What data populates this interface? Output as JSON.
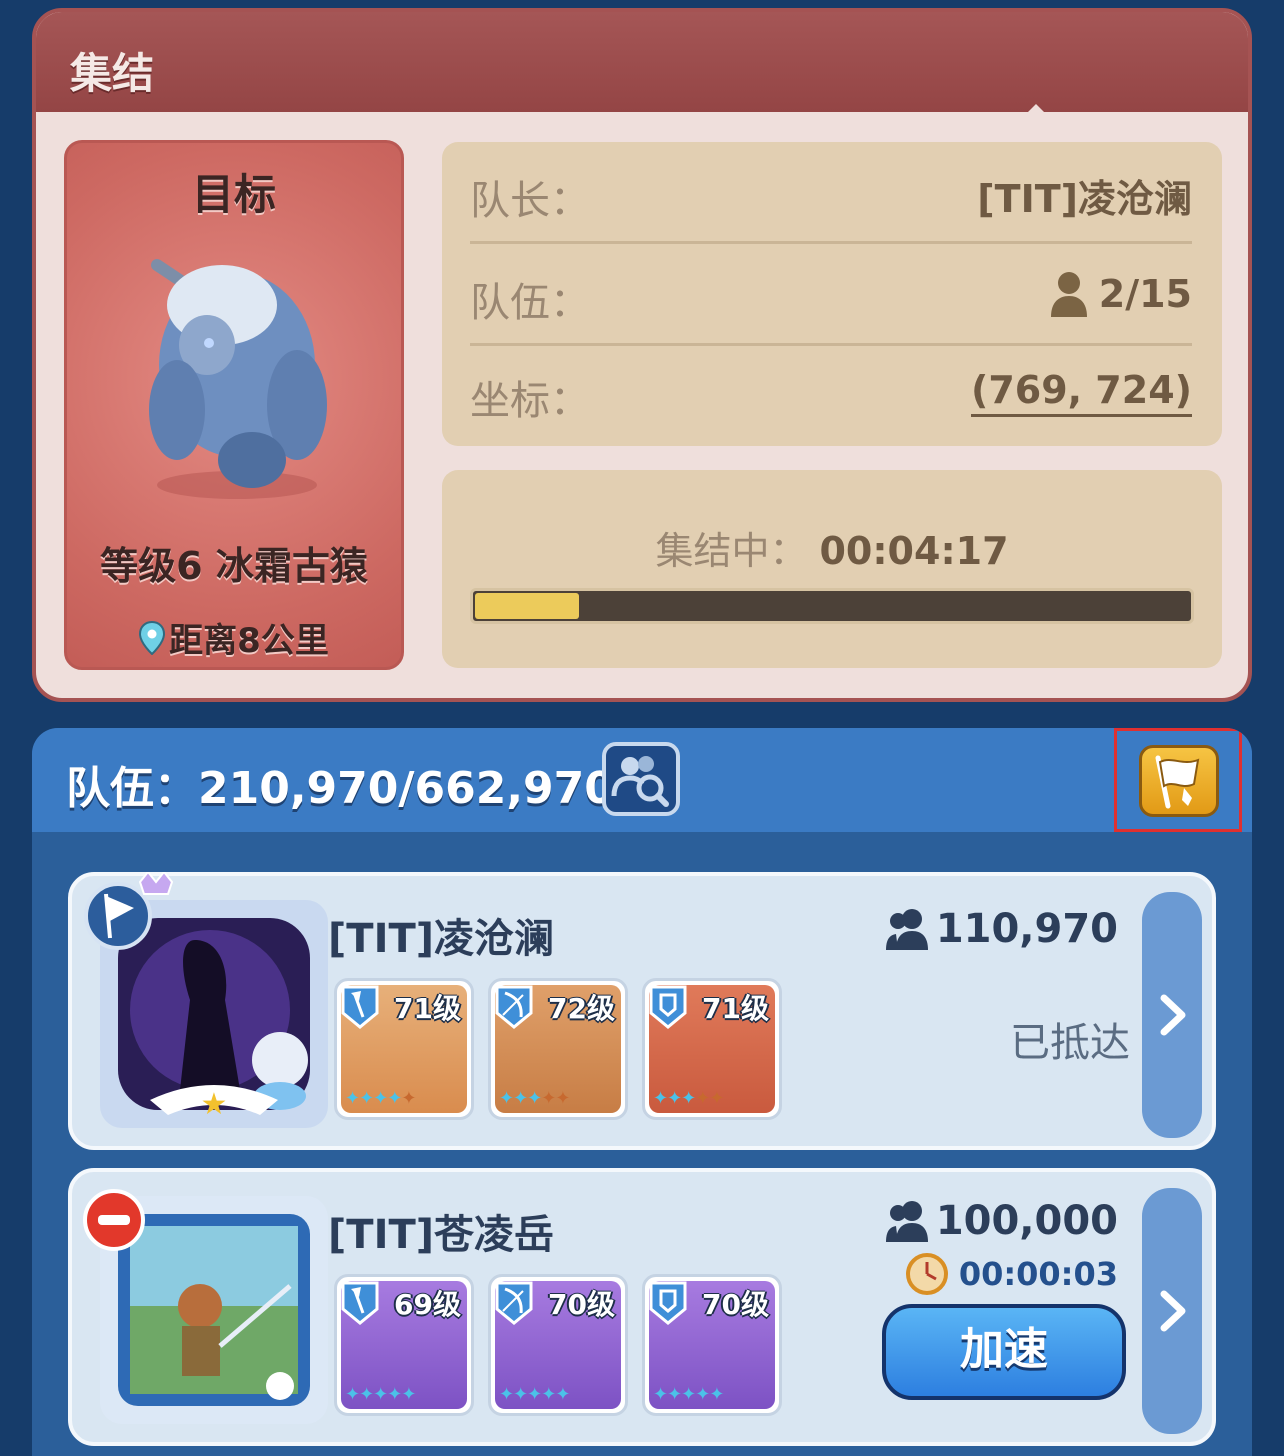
{
  "rally": {
    "title": "集结",
    "target": {
      "label": "目标",
      "monster_name": "等级6 冰霜古猿",
      "distance": "距离8公里"
    },
    "leader_label": "队长：",
    "leader_value": "[TIT]凌沧澜",
    "team_label": "队伍：",
    "team_value": "2/15",
    "coord_label": "坐标：",
    "coord_value": "(769, 724)",
    "status_label": "集结中：",
    "status_timer": "00:04:17",
    "progress_fraction": 0.145,
    "progress_color": "#eccb5b"
  },
  "team": {
    "total": "队伍：210,970/662,970",
    "members": [
      {
        "name": "[TIT]凌沧澜",
        "troops": "110,970",
        "status": "已抵达",
        "heroes": [
          {
            "level": "71级",
            "type": "axe-icon",
            "stars": 5,
            "filled": 4
          },
          {
            "level": "72级",
            "type": "bow-icon",
            "stars": 5,
            "filled": 3
          },
          {
            "level": "71级",
            "type": "shield-icon",
            "stars": 5,
            "filled": 3
          }
        ]
      },
      {
        "name": "[TIT]苍凌岳",
        "troops": "100,000",
        "timer": "00:00:03",
        "speedup": "加速",
        "heroes": [
          {
            "level": "69级",
            "type": "axe-icon",
            "stars": 5,
            "filled": 5
          },
          {
            "level": "70级",
            "type": "bow-icon",
            "stars": 5,
            "filled": 5
          },
          {
            "level": "70级",
            "type": "shield-icon",
            "stars": 5,
            "filled": 5
          }
        ]
      }
    ]
  },
  "colors": {
    "header_red": "#a55656",
    "panel_blue": "#3b7bc4",
    "accent_gold": "#f6c443"
  }
}
